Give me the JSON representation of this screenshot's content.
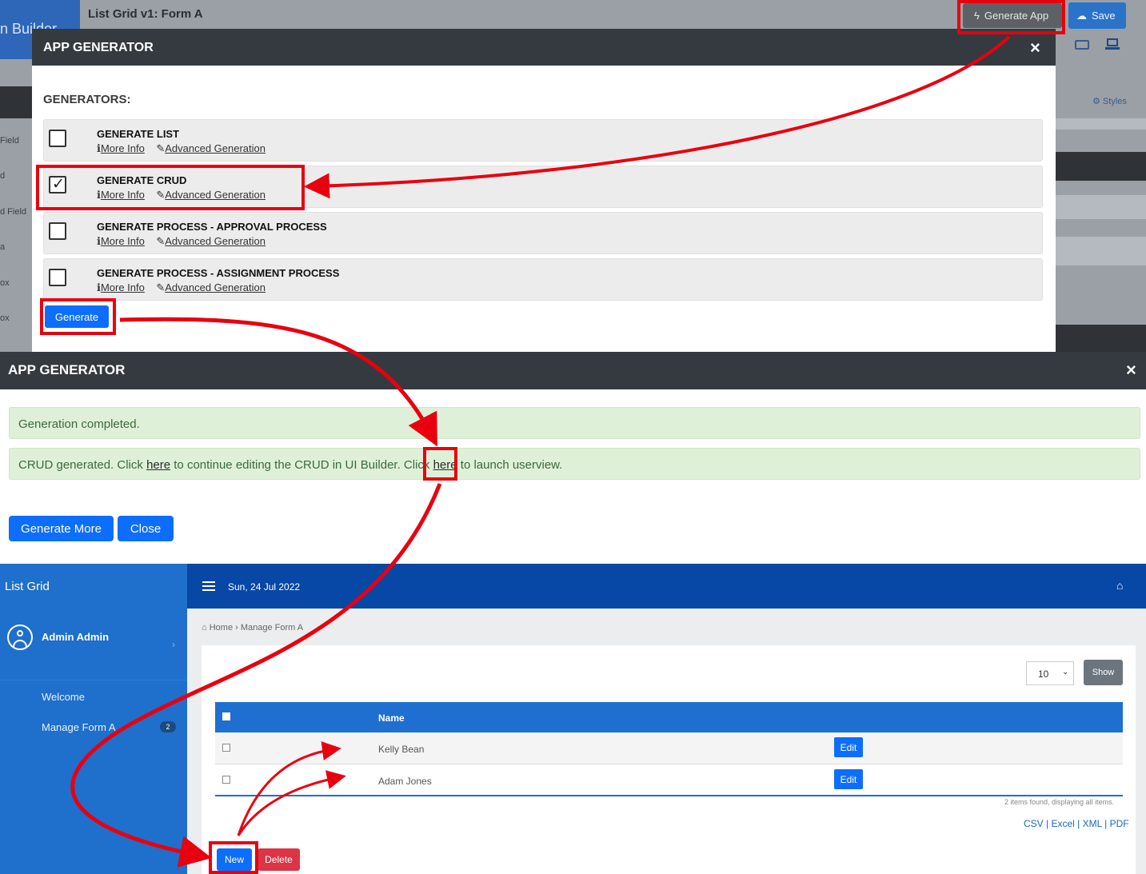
{
  "builder": {
    "brand_fragment": "n Builder",
    "form_title": "List Grid v1: Form A",
    "generate_app_label": "Generate App",
    "save_label": "Save",
    "styles_label": "Styles",
    "left_labels": [
      "Field",
      "d",
      "d Field",
      "a",
      "ox",
      "ox"
    ]
  },
  "generator_modal": {
    "title": "APP GENERATOR",
    "close_icon": "×",
    "heading": "GENERATORS:",
    "more_info_label": "More Info",
    "advanced_label": "Advanced Generation",
    "generators": [
      {
        "name": "GENERATE LIST",
        "checked": false
      },
      {
        "name": "GENERATE CRUD",
        "checked": true
      },
      {
        "name": "GENERATE PROCESS - APPROVAL PROCESS",
        "checked": false
      },
      {
        "name": "GENERATE PROCESS - ASSIGNMENT PROCESS",
        "checked": false
      }
    ],
    "generate_label": "Generate"
  },
  "result_modal": {
    "title": "APP GENERATOR",
    "close_icon": "×",
    "completed_msg": "Generation completed.",
    "crud_msg_part1": "CRUD generated. Click ",
    "here_1": "here",
    "crud_msg_part2": " to continue editing the CRUD in UI Builder. Click ",
    "here_2": "here",
    "crud_msg_part3": " to launch userview.",
    "generate_more_label": "Generate More",
    "close_label": "Close"
  },
  "userview": {
    "brand": "List Grid",
    "user_name": "Admin Admin",
    "menu": [
      {
        "label": "Welcome"
      },
      {
        "label": "Manage Form A",
        "badge": "2"
      }
    ],
    "date": "Sun, 24 Jul 2022",
    "breadcrumb_home": "Home",
    "breadcrumb_sep": "›",
    "breadcrumb_current": "Manage Form A",
    "page_size": "10",
    "show_label": "Show",
    "table": {
      "header_name": "Name",
      "rows": [
        {
          "name": "Kelly Bean",
          "action": "Edit"
        },
        {
          "name": "Adam Jones",
          "action": "Edit"
        }
      ]
    },
    "items_found": "2 items found, displaying all items.",
    "exports": "CSV | Excel | XML | PDF",
    "new_label": "New",
    "delete_label": "Delete"
  },
  "colors": {
    "annotation": "#e8000f",
    "primary": "#0d6efd",
    "modal_header": "#343a40",
    "success_bg": "#dff0d8",
    "sidebar": "#1f6fcc",
    "topnav": "#0747a6",
    "danger": "#dc3545"
  }
}
